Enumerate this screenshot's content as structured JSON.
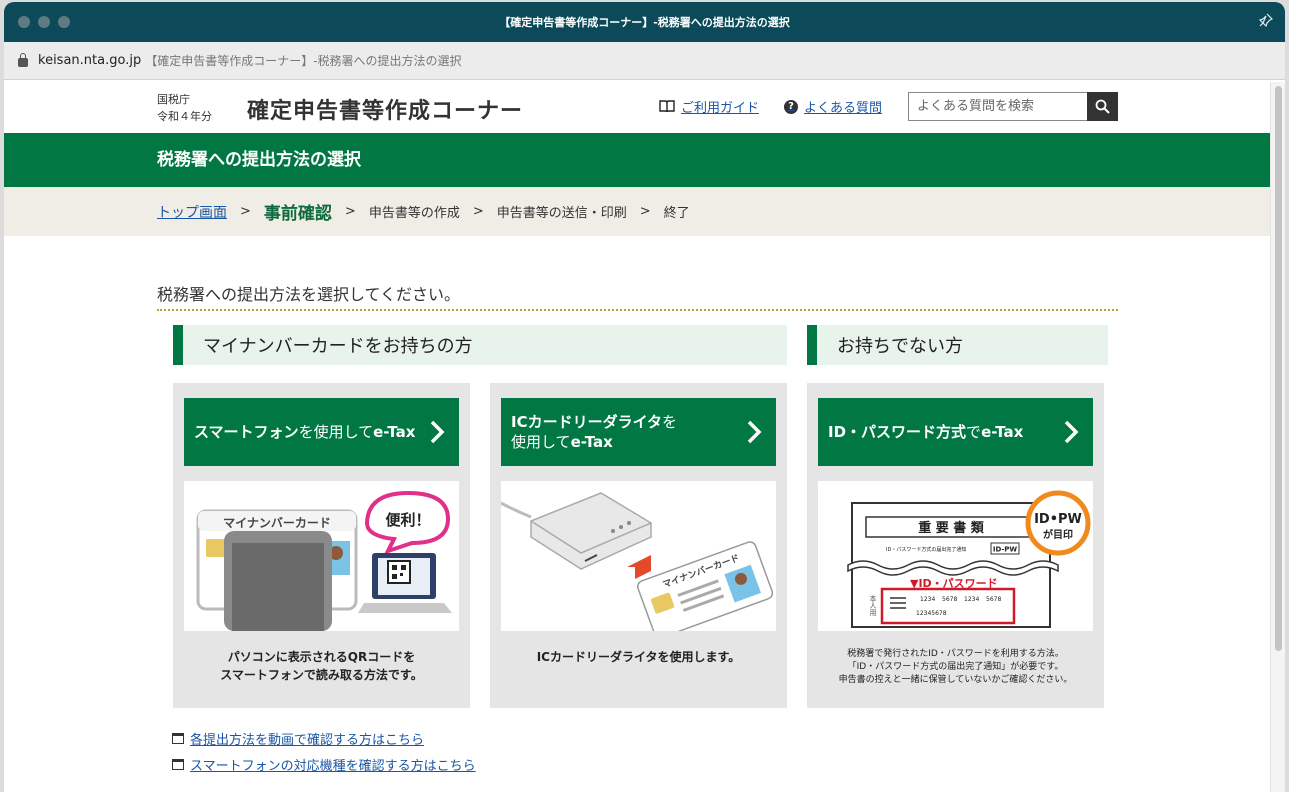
{
  "window": {
    "title": "【確定申告書等作成コーナー】-税務署への提出方法の選択"
  },
  "urlbar": {
    "host": "keisan.nta.go.jp",
    "page_title": "【確定申告書等作成コーナー】-税務署への提出方法の選択"
  },
  "header": {
    "agency": "国税庁",
    "year": "令和４年分",
    "title": "確定申告書等作成コーナー",
    "guide_link": "ご利用ガイド",
    "faq_link": "よくある質問",
    "search_placeholder": "よくある質問を検索"
  },
  "band": {
    "title": "税務署への提出方法の選択"
  },
  "breadcrumb": {
    "home": "トップ画面",
    "active": "事前確認",
    "steps": [
      "申告書等の作成",
      "申告書等の送信・印刷",
      "終了"
    ],
    "separator": ">"
  },
  "main": {
    "instruction": "税務署への提出方法を選択してください。",
    "section_with_card": "マイナンバーカードをお持ちの方",
    "section_without_card": "お持ちでない方",
    "cards": [
      {
        "button_bold_1": "スマートフォン",
        "button_normal": "を使用して",
        "button_bold_2": "e-Tax",
        "image_text": "マイナンバーカード",
        "bubble": "便利！",
        "desc_line1": "パソコンに表示されるQRコードを",
        "desc_line2": "スマートフォンで読み取る方法です。"
      },
      {
        "button_bold_1": "ICカードリーダライタ",
        "button_normal": "を",
        "button_line2_normal": "使用して",
        "button_bold_2": "e-Tax",
        "image_text": "マイナンバーカード",
        "desc_line1": "ICカードリーダライタを使用します。"
      },
      {
        "button_bold_1": "ID・パスワード方式",
        "button_normal": "で",
        "button_bold_2": "e-Tax",
        "image_heading": "重 要 書 類",
        "image_sub": "ID・パスワード方式の届出完了通知",
        "image_idpw_tag": "ID-PW",
        "image_banner": "▼ID・パスワード",
        "image_vertical": "本人用",
        "image_ids": [
          "1234",
          "5678",
          "1234",
          "5678"
        ],
        "image_id2": "12345678",
        "stamp_line1": "ID•PW",
        "stamp_line2": "が目印",
        "desc_line1": "税務署で発行されたID・パスワードを利用する方法。",
        "desc_line2": "「ID・パスワード方式の届出完了通知」が必要です。",
        "desc_line3": "申告書の控えと一緒に保管していないかご確認ください。"
      }
    ],
    "link_video": "各提出方法を動画で確認する方はこちら",
    "link_smartphone": "スマートフォンの対応機種を確認する方はこちら"
  },
  "colors": {
    "brand_green": "#017844",
    "titlebar": "#0c4a5a",
    "crumb_bg": "#efede5",
    "link": "#1a56a8"
  }
}
